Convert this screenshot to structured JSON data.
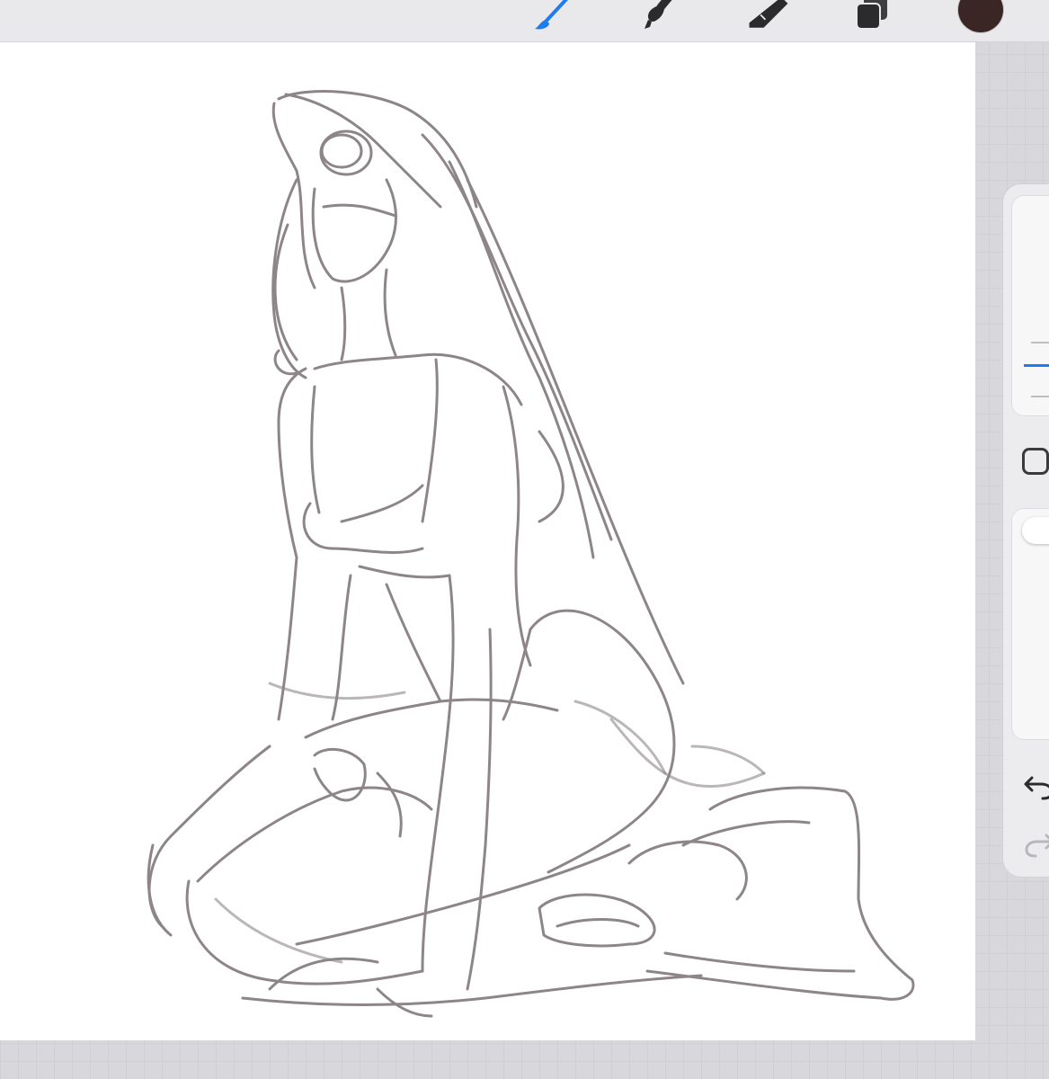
{
  "toolbar": {
    "tools": [
      {
        "name": "brush-icon",
        "active": true
      },
      {
        "name": "smudge-icon",
        "active": false
      },
      {
        "name": "eraser-icon",
        "active": false
      },
      {
        "name": "layers-icon",
        "active": false
      }
    ],
    "current_color": "#3b2626"
  },
  "colors": {
    "accent": "#1e7cf2",
    "sketch_stroke": "#7a7073",
    "canvas_background": "#ffffff"
  },
  "sidebar": {
    "brush_size_level": 0.25,
    "brush_opacity_level": 1.0,
    "undo_icon": "undo-icon",
    "redo_icon": "redo-icon",
    "redo_enabled": false
  },
  "canvas": {
    "content": "pencil-sketch-kneeling-figure"
  }
}
